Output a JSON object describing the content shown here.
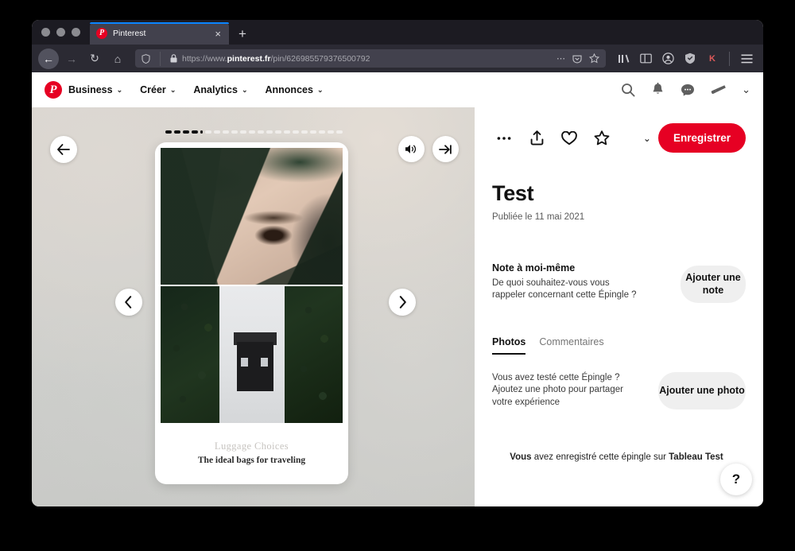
{
  "browser": {
    "tab": {
      "title": "Pinterest",
      "favicon": "pinterest-icon",
      "close_label": "×"
    },
    "new_tab_label": "+",
    "nav": {
      "back": "←",
      "forward": "→",
      "reload": "↻",
      "home": "⌂"
    },
    "url": {
      "scheme": "https://www.",
      "domain": "pinterest.fr",
      "path": "/pin/626985579376500792",
      "full": "https://www.pinterest.fr/pin/626985579376500792",
      "shield_icon": "shield-icon",
      "lock_icon": "lock-icon",
      "more_icon": "ellipsis-icon",
      "pocket_icon": "pocket-icon",
      "bookmark_icon": "star-icon"
    },
    "toolbar_icons": [
      {
        "name": "library-icon",
        "glyph": "‖\\"
      },
      {
        "name": "sidebar-icon",
        "glyph": "▤"
      },
      {
        "name": "account-icon",
        "glyph": "☺"
      },
      {
        "name": "shield-extension-icon",
        "glyph": "⛨"
      },
      {
        "name": "k-extension-icon",
        "glyph": "K"
      },
      {
        "name": "menu-icon",
        "glyph": "☰"
      }
    ]
  },
  "pinterest_header": {
    "logo": "pinterest-logo",
    "nav_items": [
      {
        "label": "Business",
        "caret": "⌄"
      },
      {
        "label": "Créer",
        "caret": "⌄"
      },
      {
        "label": "Analytics",
        "caret": "⌄"
      },
      {
        "label": "Annonces",
        "caret": "⌄"
      }
    ],
    "right_icons": [
      {
        "name": "search-icon"
      },
      {
        "name": "notifications-bell-icon"
      },
      {
        "name": "messages-icon"
      },
      {
        "name": "ads-megaphone-icon"
      },
      {
        "name": "account-chevron-icon",
        "glyph": "⌄"
      }
    ]
  },
  "viewer": {
    "back_button": {
      "name": "back-arrow-button",
      "glyph": "←"
    },
    "volume_button": {
      "name": "volume-button"
    },
    "skip_button": {
      "name": "skip-to-end-button"
    },
    "prev_button": {
      "name": "previous-slide-button",
      "glyph": "‹"
    },
    "next_button": {
      "name": "next-slide-button",
      "glyph": "›"
    },
    "progress": {
      "total": 21,
      "filled": 4
    },
    "card": {
      "photo_1_alt": "close-up-face-behind-green-leaves",
      "photo_2_alt": "woman-holding-black-satchel-bag-against-ivy",
      "caption_title": "Luggage Choices",
      "caption_subtitle": "The ideal bags for traveling"
    }
  },
  "panel": {
    "actions": [
      {
        "name": "more-options-button",
        "glyph": "•••"
      },
      {
        "name": "share-button"
      },
      {
        "name": "favorite-heart-button"
      },
      {
        "name": "star-button"
      }
    ],
    "board_chevron": "⌄",
    "save_label": "Enregistrer",
    "title": "Test",
    "date": "Publiée le 11 mai 2021",
    "note": {
      "heading": "Note à moi-même",
      "description": "De quoi souhaitez-vous vous rappeler concernant cette Épingle ?",
      "button_label": "Ajouter une note"
    },
    "tabs": [
      {
        "label": "Photos",
        "selected": true
      },
      {
        "label": "Commentaires",
        "selected": false
      }
    ],
    "photos_section": {
      "description": "Vous avez testé cette Épingle ? Ajoutez une photo pour partager votre expérience",
      "button_label": "Ajouter une photo"
    },
    "saved_notice": {
      "prefix": "Vous",
      "middle": " avez enregistré cette épingle sur ",
      "board": "Tableau Test"
    },
    "help_button": {
      "name": "help-button",
      "glyph": "?"
    }
  },
  "colors": {
    "brand_red": "#e60023",
    "chrome_dark": "#2b2a33",
    "tab_strip": "#1c1b22",
    "gray_button": "#efefef"
  }
}
